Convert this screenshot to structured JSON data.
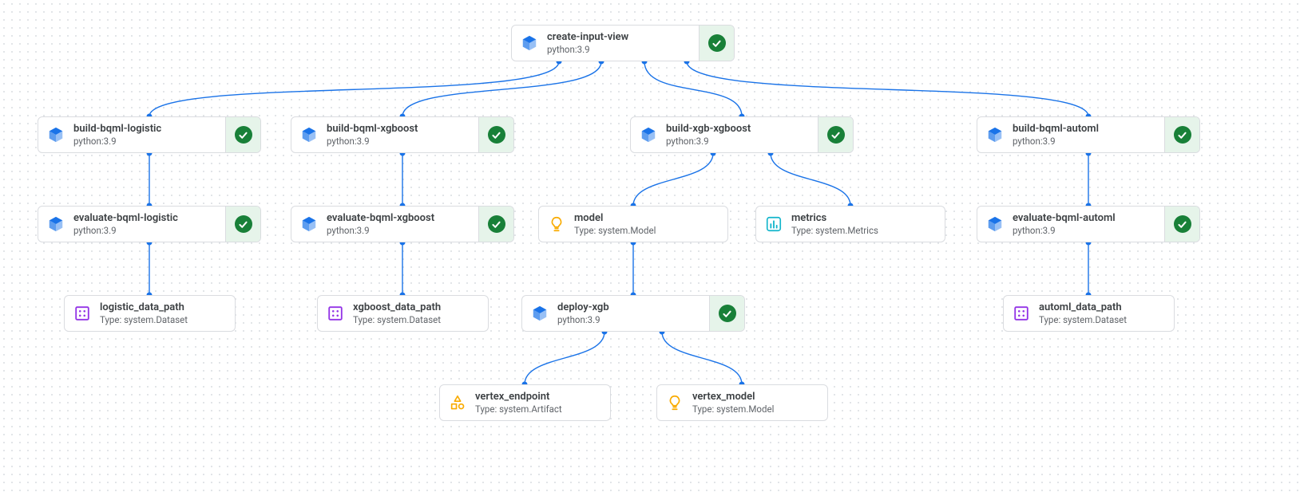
{
  "nodes": {
    "root": {
      "title": "create-input-view",
      "subtitle": "python:3.9"
    },
    "build_logistic": {
      "title": "build-bqml-logistic",
      "subtitle": "python:3.9"
    },
    "eval_logistic": {
      "title": "evaluate-bqml-logistic",
      "subtitle": "python:3.9"
    },
    "logistic_data": {
      "title": "logistic_data_path",
      "subtitle": "Type: system.Dataset"
    },
    "build_xgboost": {
      "title": "build-bqml-xgboost",
      "subtitle": "python:3.9"
    },
    "eval_xgboost": {
      "title": "evaluate-bqml-xgboost",
      "subtitle": "python:3.9"
    },
    "xgboost_data": {
      "title": "xgboost_data_path",
      "subtitle": "Type: system.Dataset"
    },
    "build_xgb": {
      "title": "build-xgb-xgboost",
      "subtitle": "python:3.9"
    },
    "model": {
      "title": "model",
      "subtitle": "Type: system.Model"
    },
    "metrics": {
      "title": "metrics",
      "subtitle": "Type: system.Metrics"
    },
    "deploy_xgb": {
      "title": "deploy-xgb",
      "subtitle": "python:3.9"
    },
    "vertex_endpoint": {
      "title": "vertex_endpoint",
      "subtitle": "Type: system.Artifact"
    },
    "vertex_model": {
      "title": "vertex_model",
      "subtitle": "Type: system.Model"
    },
    "build_automl": {
      "title": "build-bqml-automl",
      "subtitle": "python:3.9"
    },
    "eval_automl": {
      "title": "evaluate-bqml-automl",
      "subtitle": "python:3.9"
    },
    "automl_data": {
      "title": "automl_data_path",
      "subtitle": "Type: system.Dataset"
    }
  }
}
